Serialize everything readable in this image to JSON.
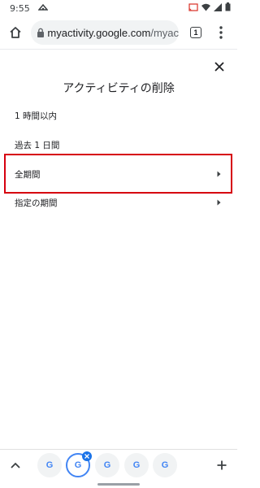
{
  "status_bar": {
    "time": "9:55"
  },
  "browser": {
    "url_host": "myactivity.google.com",
    "url_rest": "/myac",
    "tab_count": "1"
  },
  "dialog": {
    "title": "アクティビティの削除",
    "options": [
      {
        "label": "1 時間以内",
        "has_chevron": false
      },
      {
        "label": "過去 1 日間",
        "has_chevron": false
      },
      {
        "label": "全期間",
        "has_chevron": true,
        "highlighted": true
      },
      {
        "label": "指定の期間",
        "has_chevron": true
      }
    ]
  },
  "tab_strip": {
    "tabs": [
      {
        "icon": "google-g-icon",
        "active": false
      },
      {
        "icon": "google-g-icon",
        "active": true
      },
      {
        "icon": "google-g-icon",
        "active": false
      },
      {
        "icon": "google-g-icon",
        "active": false
      },
      {
        "icon": "google-g-icon",
        "active": false
      }
    ]
  },
  "colors": {
    "highlight": "#d6000f",
    "active_tab": "#4285f4"
  }
}
